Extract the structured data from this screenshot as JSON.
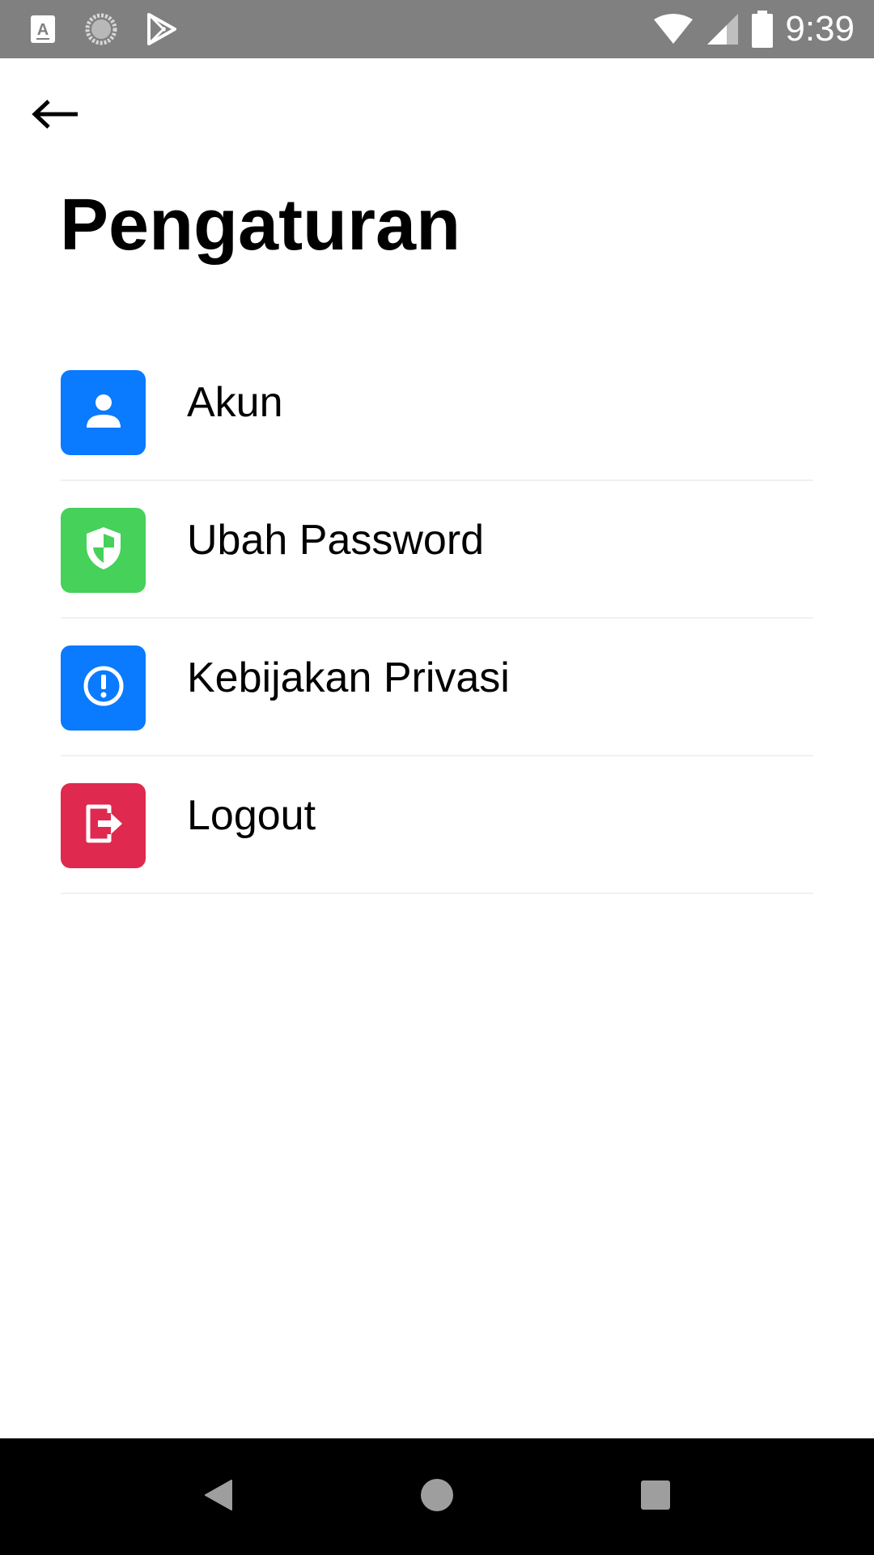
{
  "status_bar": {
    "time": "9:39",
    "icons_left": [
      "text-a-icon",
      "loading-circle-icon",
      "play-store-icon"
    ],
    "icons_right": [
      "wifi-icon",
      "cell-signal-icon",
      "battery-icon"
    ]
  },
  "header": {
    "back_icon": "arrow-left-icon",
    "title": "Pengaturan"
  },
  "settings": {
    "items": [
      {
        "label": "Akun",
        "icon": "user-icon",
        "color": "#0A7AFF"
      },
      {
        "label": "Ubah Password",
        "icon": "shield-icon",
        "color": "#45D15A"
      },
      {
        "label": "Kebijakan Privasi",
        "icon": "info-circle-icon",
        "color": "#0A7AFF"
      },
      {
        "label": "Logout",
        "icon": "logout-icon",
        "color": "#E0294F"
      }
    ]
  },
  "nav_bar": {
    "buttons": [
      "back-triangle-icon",
      "home-circle-icon",
      "recents-square-icon"
    ]
  }
}
